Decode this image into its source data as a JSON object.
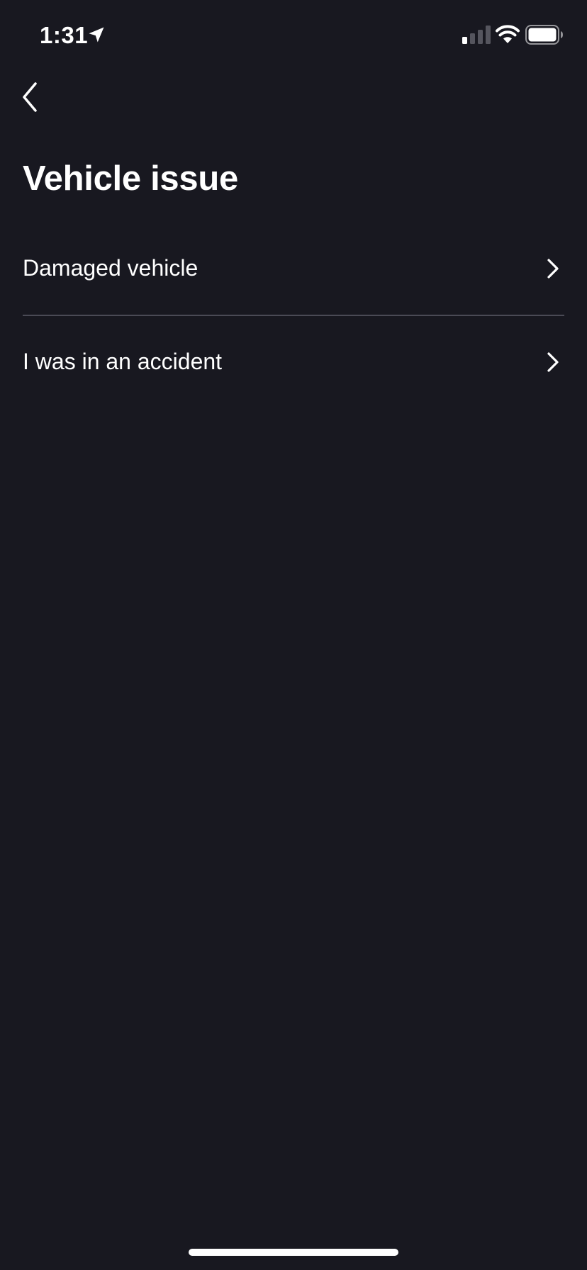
{
  "status_bar": {
    "time": "1:31",
    "location_icon": "location-arrow-icon",
    "signal_icon": "cellular-signal-icon",
    "wifi_icon": "wifi-icon",
    "battery_icon": "battery-icon"
  },
  "nav": {
    "back_icon": "chevron-left-icon"
  },
  "page": {
    "title": "Vehicle issue"
  },
  "menu": {
    "items": [
      {
        "label": "Damaged vehicle",
        "icon": "chevron-right-icon"
      },
      {
        "label": "I was in an accident",
        "icon": "chevron-right-icon"
      }
    ]
  },
  "colors": {
    "background": "#181820",
    "text": "#ffffff",
    "divider": "#4a4a55"
  }
}
